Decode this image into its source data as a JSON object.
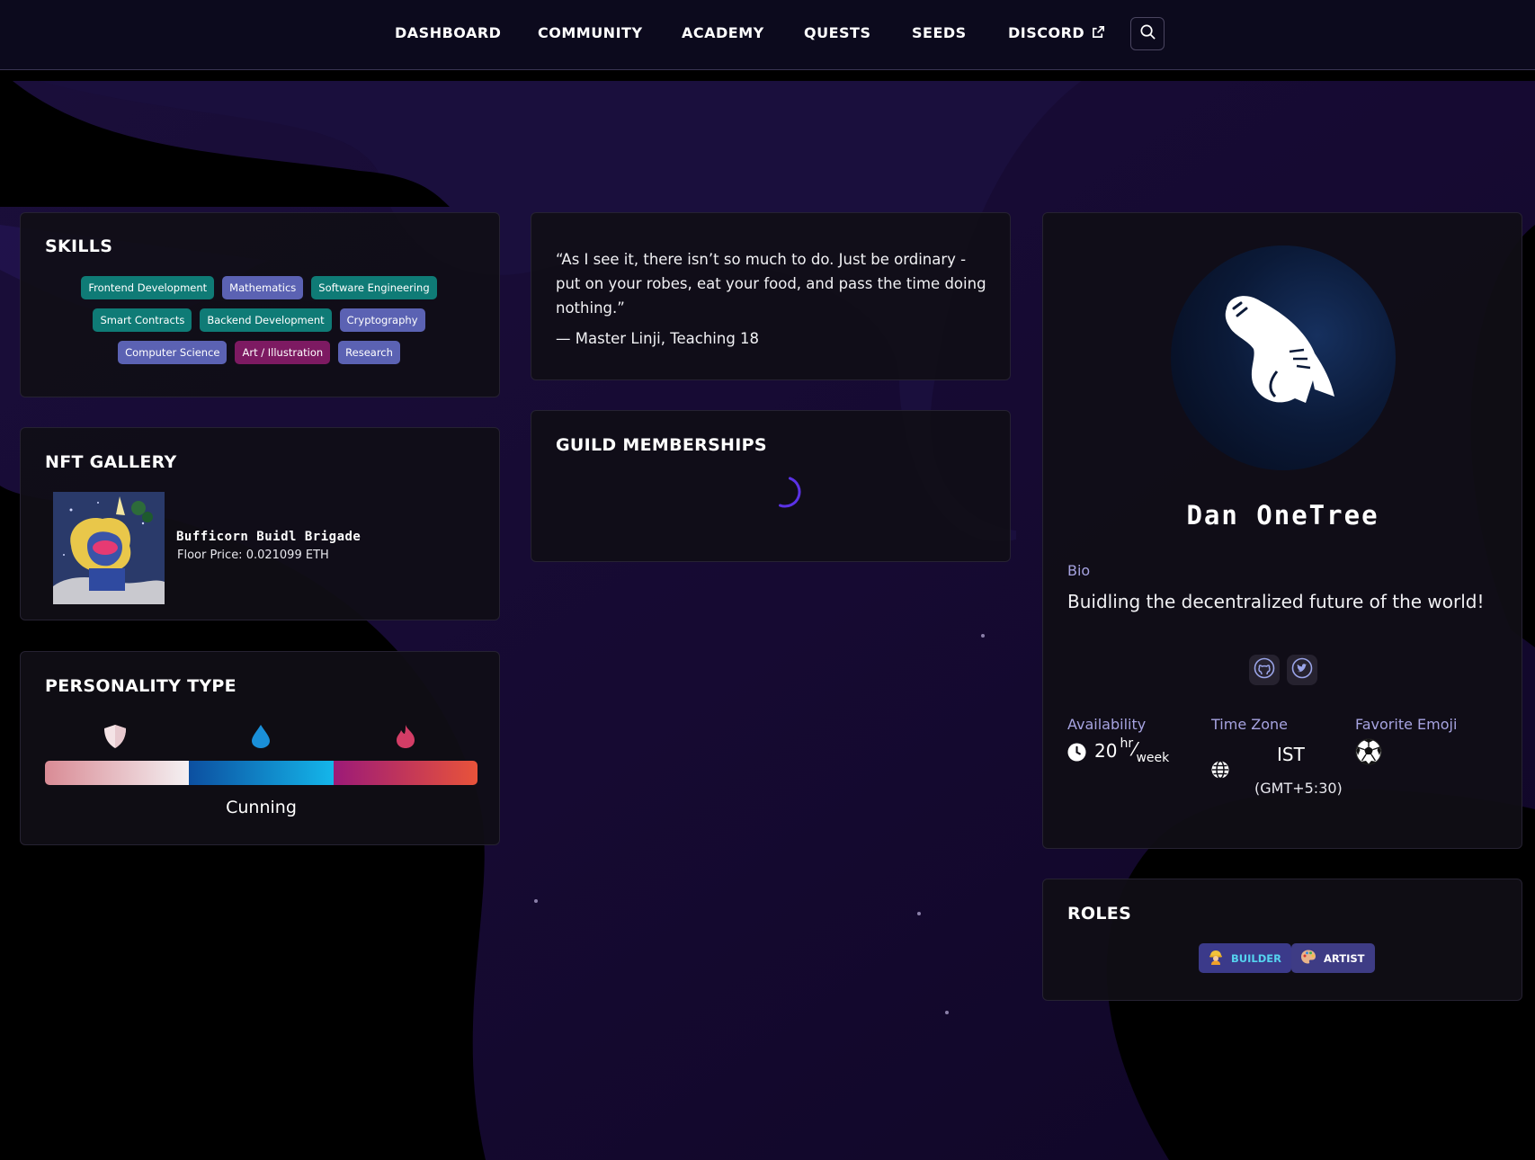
{
  "nav": {
    "items": [
      "DASHBOARD",
      "COMMUNITY",
      "ACADEMY",
      "QUESTS",
      "SEEDS",
      "DISCORD"
    ]
  },
  "skills": {
    "title": "SKILLS",
    "tags": [
      {
        "label": "Frontend Development",
        "color": "#0f7b76"
      },
      {
        "label": "Mathematics",
        "color": "#5b62b3"
      },
      {
        "label": "Software Engineering",
        "color": "#0f7b76"
      },
      {
        "label": "Smart Contracts",
        "color": "#0f7b76"
      },
      {
        "label": "Backend Development",
        "color": "#0f7b76"
      },
      {
        "label": "Cryptography",
        "color": "#5b62b3"
      },
      {
        "label": "Computer Science",
        "color": "#5b62b3"
      },
      {
        "label": "Art / Illustration",
        "color": "#7d1a62"
      },
      {
        "label": "Research",
        "color": "#5b62b3"
      }
    ]
  },
  "nft": {
    "title": "NFT GALLERY",
    "name": "Bufficorn Buidl Brigade",
    "price": "Floor Price: 0.021099 ETH"
  },
  "personality": {
    "title": "PERSONALITY TYPE",
    "icons": [
      "shield-icon",
      "water-drop-icon",
      "flame-icon"
    ],
    "label": "Cunning"
  },
  "quote": {
    "text": "“As I see it, there isn’t so much to do. Just be ordinary - put on your robes, eat your food, and pass the time doing nothing.”",
    "author": "— Master Linji, Teaching 18"
  },
  "guilds": {
    "title": "GUILD MEMBERSHIPS"
  },
  "profile": {
    "name": "Dan OneTree",
    "bio_label": "Bio",
    "bio": "Buidling the decentralized future of the world!",
    "availability_label": "Availability",
    "availability_value": "20",
    "availability_unit_top": "hr",
    "availability_unit_bottom": "week",
    "timezone_label": "Time Zone",
    "timezone": "IST",
    "timezone_offset": "(GMT+5:30)",
    "emoji_label": "Favorite Emoji",
    "emoji": "⚽"
  },
  "roles": {
    "title": "ROLES",
    "items": [
      {
        "label": "BUILDER",
        "icon": "👷"
      },
      {
        "label": "ARTIST",
        "icon": "🎨"
      }
    ]
  },
  "colors": {
    "accent": "#a6a3e0",
    "nav_bg": "#0c0a1d",
    "card_bg": "#100e16",
    "spinner": "#5b32e6"
  }
}
